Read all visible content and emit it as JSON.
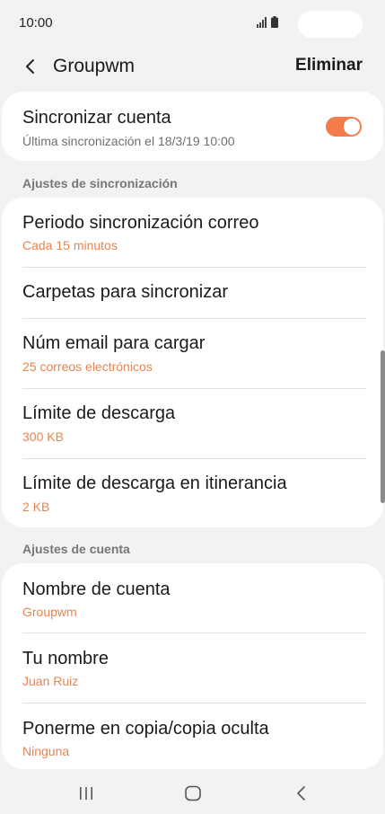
{
  "status_bar": {
    "time": "10:00"
  },
  "header": {
    "title": "Groupwm",
    "delete_label": "Eliminar"
  },
  "sync_account": {
    "title": "Sincronizar cuenta",
    "last_sync": "Última sincronización el 18/3/19  10:00",
    "toggle_on": true
  },
  "sections": {
    "sync_settings": "Ajustes de sincronización",
    "account_settings": "Ajustes de cuenta"
  },
  "sync_settings": [
    {
      "title": "Periodo sincronización correo",
      "value": "Cada 15 minutos"
    },
    {
      "title": "Carpetas para sincronizar"
    },
    {
      "title": "Núm email para cargar",
      "value": "25 correos electrónicos"
    },
    {
      "title": "Límite de descarga",
      "value": "300 KB"
    },
    {
      "title": "Límite de descarga en itinerancia",
      "value": "2 KB"
    }
  ],
  "account_settings": [
    {
      "title": "Nombre de cuenta",
      "value": "Groupwm"
    },
    {
      "title": "Tu nombre",
      "value": "Juan Ruiz"
    },
    {
      "title": "Ponerme en copia/copia oculta",
      "value": "Ninguna"
    }
  ],
  "colors": {
    "accent": "#f47c4a",
    "subtitle_accent": "#e8844f",
    "background": "#f2f2f2",
    "card": "#ffffff"
  },
  "icons": {
    "back": "chevron-left-icon",
    "signal": "signal-icon",
    "battery": "battery-icon",
    "nav_recent": "recent-apps-icon",
    "nav_home": "home-icon",
    "nav_back": "nav-back-icon"
  }
}
